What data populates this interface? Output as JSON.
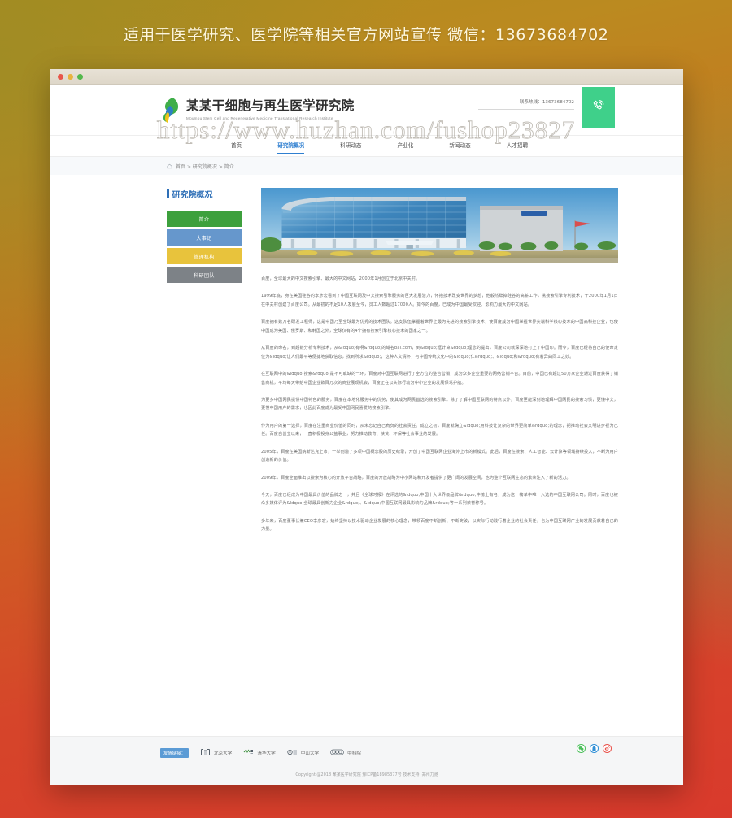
{
  "banner": {
    "text": "适用于医学研究、医学院等相关官方网站宣传  微信：13673684702"
  },
  "watermark": {
    "text": "https://www.huzhan.com/fushop23827"
  },
  "browser": {
    "dots": [
      "close",
      "minimize",
      "zoom"
    ]
  },
  "header": {
    "logo_cn": "某某干细胞与再生医学研究院",
    "logo_en": "Moumou Stem Cell and Regenerative Medicine Translational Research Institute",
    "contact_label": "联系热线：13673684702",
    "phone_icon": "phone-icon"
  },
  "nav": {
    "items": [
      {
        "label": "首页",
        "active": false
      },
      {
        "label": "研究院概况",
        "active": true
      },
      {
        "label": "科研动态",
        "active": false
      },
      {
        "label": "产业化",
        "active": false
      },
      {
        "label": "新闻动态",
        "active": false
      },
      {
        "label": "人才招聘",
        "active": false
      }
    ]
  },
  "breadcrumb": {
    "icon": "home-icon",
    "text": "首页 > 研究院概况 > 简介"
  },
  "sidebar": {
    "title": "研究院概况",
    "items": [
      {
        "label": "简介",
        "color": "#3da03d"
      },
      {
        "label": "大事记",
        "color": "#6697cc"
      },
      {
        "label": "管理机构",
        "color": "#e8c33c"
      },
      {
        "label": "科研团队",
        "color": "#7d8287"
      }
    ]
  },
  "content": {
    "hero_alt": "研究院大楼",
    "paragraphs": [
      "百度，全球最大的中文搜索引擎、最大的中文网站，2000年1月创立于北京中关村。",
      "1999年底，身在美国硅谷的李彦宏看到了中国互联网及中文搜索引擎服务的巨大发展潜力，怀抱技术改变世界的梦想，他毅然辞掉硅谷的高薪工作，携搜索引擎专利技术，于2000年1月1日在中关村创建了百度公司。从最初的不足10人发展至今，员工人数超过17000人。如今的百度，已成为中国最受欢迎、影响力最大的中文网站。",
      "百度拥有数万名研发工程师，这是中国乃至全球最为优秀的技术团队。这支队伍掌握着世界上最为先进的搜索引擎技术，使百度成为中国掌握世界尖端科学核心技术的中国高科技企业，也使中国成为美国、俄罗斯、和韩国之外，全球仅有的4个拥有搜索引擎核心技术的国家之一。",
      "从百度的命名，到超链分析专利技术，从&ldquo;有啊&rdquo;的域名bai.com，到&ldquo;框计算&rdquo;理念的提出，百度公司就深深地打上了中国印。而今，百度已经将自己的使命定位为&ldquo;让人们最平等便捷地获取信息，找到所求&rdquo;，这种人文情怀，与中国传统文化中的&ldquo;仁&rdquo;、&ldquo;和&rdquo;有着异曲同工之妙。",
      "在互联网中的&ldquo;搜索&rdquo;是不可或缺的一环，百度对中国互联网进行了全方位的整合营销，成为众多企业重要的网络营销平台。目前，中国已有超过50万家企业通过百度获得了销售商机，平均每天带给中国企业数百万次的商业展现机会，百度正在以实际行动为中小企业的发展保驾护航。",
      "为更多中国网民提供中国特色的服务，百度在本地化服务中的优势，使其成为网民首选的搜索引擎。除了了解中国互联网的特点以外，百度更能深刻地理解中国网民的搜索习惯，更懂中文，更懂中国用户的需求，也因此百度成为最受中国网民喜爱的搜索引擎。",
      "作为用户的第一选择，百度在注重商业价值的同时，从未忘记自己肩负的社会责任。成立之初，百度就确立&ldquo;用科技让复杂的世界更简单&rdquo;的理念，把推动社会文明进步视为己任。百度自创立以来，一直积极投身公益事业，努力推动教育、扶贫、环保等社会事业的发展。",
      "2005年，百度在美国纳斯达克上市，一举创造了多项中国概念股的历史纪录，开创了中国互联网企业海外上市的新模式。此后，百度在搜索、人工智能、云计算等领域持续投入，不断为用户创造新的价值。",
      "2009年，百度全面推出以搜索为核心的开放平台战略，百度的开放战略为中小网站和开发者提供了更广阔的发展空间，也为整个互联网生态的繁荣注入了新的活力。",
      "今天，百度已经成为中国最具价值的品牌之一，并且《全球时报》在评选的&ldquo;中国十大世界级品牌&rdquo;中榜上有名，成为这一榜单中唯一入选的中国互联网公司。同时，百度也被众多媒体评为&ldquo;全球最具创新力企业&rdquo;、&ldquo;中国互联网最具影响力品牌&rdquo;等一系列荣誉称号。",
      "多年来，百度董事长兼CEO李彦宏，始终坚持以技术驱动企业发展的核心理念，带领百度不断创新、不断突破，以实际行动践行着企业的社会责任，也为中国互联网产业的发展贡献着自己的力量。"
    ]
  },
  "footer": {
    "links_label": "友情链接：",
    "links": [
      {
        "name": "北京大学",
        "logo": "peking-university-logo"
      },
      {
        "name": "清华大学",
        "logo": "tsinghua-university-logo"
      },
      {
        "name": "中山大学",
        "logo": "sun-yat-sen-university-logo"
      },
      {
        "name": "中科院",
        "logo": "cas-logo"
      }
    ],
    "social": [
      {
        "name": "wechat-icon",
        "color": "#4cbf5b"
      },
      {
        "name": "qq-icon",
        "color": "#2f8fd6"
      },
      {
        "name": "weibo-icon",
        "color": "#e8514a"
      }
    ],
    "copyright": "Copyright @2018 某某医学研究院   豫ICP备18985377号   技术支持: 郑州力驰"
  }
}
